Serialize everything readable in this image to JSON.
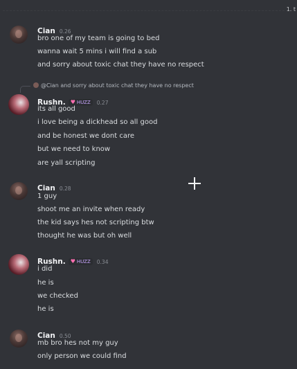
{
  "page_marker": "1. t",
  "reply": {
    "mention": "@Cian",
    "text": "and sorry about toxic chat they have no respect"
  },
  "groups": [
    {
      "user": "Cian",
      "time": "0.26",
      "badge": "",
      "lines": [
        "bro one of my team is going to bed",
        "wanna wait 5 mins i will find a sub",
        "and sorry about toxic chat they have no respect"
      ]
    },
    {
      "user": "Rushn.",
      "time": "0.27",
      "badge": "HUZZ",
      "lines": [
        "its all good",
        "i love being a dickhead so all good",
        "and be honest we dont care",
        "but we need to know",
        "are yall scripting"
      ]
    },
    {
      "user": "Cian",
      "time": "0.28",
      "badge": "",
      "lines": [
        "1 guy",
        "shoot me an invite when ready",
        "the kid says hes not scripting btw",
        "thought he was but oh well"
      ]
    },
    {
      "user": "Rushn.",
      "time": "0.34",
      "badge": "HUZZ",
      "lines": [
        "i did",
        "he is",
        "we checked",
        "he is"
      ]
    },
    {
      "user": "Cian",
      "time": "0.50",
      "badge": "",
      "lines": [
        "mb bro hes not my guy",
        "only person we could find"
      ]
    }
  ],
  "colors": {
    "background": "#313338",
    "username": "#f2f3f5",
    "message_text": "#dbdee1",
    "timestamp": "#8a8e95",
    "badge_text": "#c9a6ff",
    "badge_heart": "#ff6fb1"
  }
}
